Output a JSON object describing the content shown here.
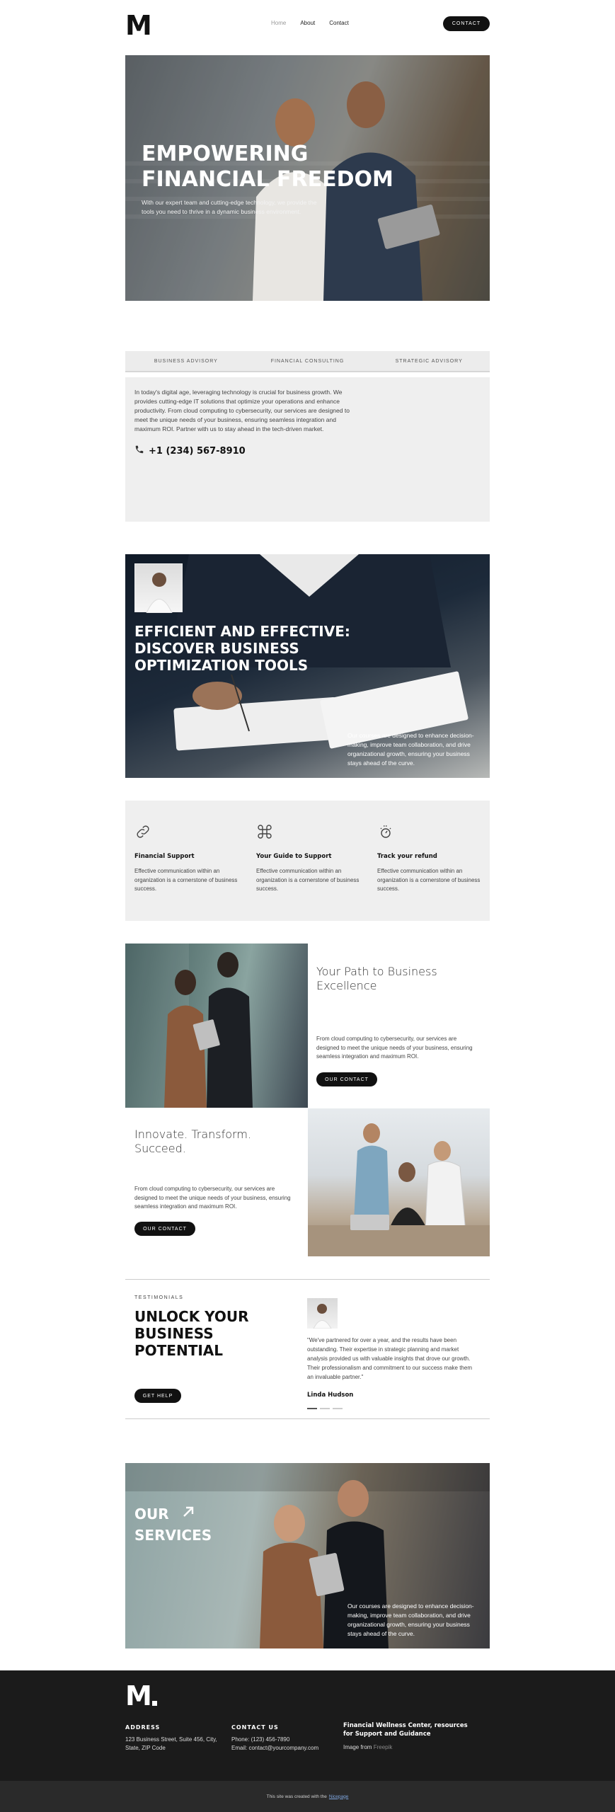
{
  "header": {
    "logo": "M",
    "nav": [
      "Home",
      "About",
      "Contact"
    ],
    "contact_button": "CONTACT"
  },
  "hero": {
    "title": "EMPOWERING FINANCIAL FREEDOM",
    "subtitle": "With our expert team and cutting-edge technology, we provide the tools you need to thrive in a dynamic business environment."
  },
  "tabs": [
    "BUSINESS ADVISORY",
    "FINANCIAL CONSULTING",
    "STRATEGIC ADVISORY"
  ],
  "panel": {
    "text": "In today's digital age, leveraging technology is crucial for business growth. We provides cutting-edge IT solutions that optimize your operations and enhance productivity. From cloud computing to cybersecurity, our services are designed to meet the unique needs of your business, ensuring seamless integration and maximum ROI. Partner with us to stay ahead in the tech-driven market.",
    "phone": "+1 (234) 567-8910"
  },
  "banner": {
    "title": "EFFICIENT AND EFFECTIVE: DISCOVER BUSINESS OPTIMIZATION TOOLS",
    "text": "Our courses are designed to enhance decision-making, improve team collaboration, and drive organizational growth, ensuring your business stays ahead of the curve."
  },
  "features": [
    {
      "icon": "link-icon",
      "title": "Financial Support",
      "text": "Effective communication within an organization is a cornerstone of business success."
    },
    {
      "icon": "command-icon",
      "title": "Your Guide to Support",
      "text": "Effective communication within an organization is a cornerstone of business success."
    },
    {
      "icon": "timer-icon",
      "title": "Track your refund",
      "text": "Effective communication within an organization is a cornerstone of business success."
    }
  ],
  "path": {
    "title": "Your Path to Business Excellence",
    "text": "From cloud computing to cybersecurity, our services are designed to meet the unique needs of your business, ensuring seamless integration and maximum ROI.",
    "button": "OUR CONTACT"
  },
  "innovate": {
    "title": "Innovate. Transform. Succeed.",
    "text": "From cloud computing to cybersecurity, our services are designed to meet the unique needs of your business, ensuring seamless integration and maximum ROI.",
    "button": "OUR CONTACT"
  },
  "testimonials": {
    "label": "TESTIMONIALS",
    "title": "UNLOCK YOUR BUSINESS POTENTIAL",
    "button": "GET HELP",
    "quote": "\"We've partnered for over a year, and the results have been outstanding. Their expertise in strategic planning and market analysis provided us with valuable insights that drove our growth. Their professionalism and commitment to our success make them an invaluable partner.\"",
    "name": "Linda Hudson"
  },
  "services": {
    "title": "OUR SERVICES",
    "text": "Our courses are designed to enhance decision-making, improve team collaboration, and drive organizational growth, ensuring your business stays ahead of the curve."
  },
  "footer": {
    "address_heading": "ADDRESS",
    "address": "123 Business Street, Suite 456, City, State, ZIP Code",
    "contact_heading": "CONTACT US",
    "phone": "Phone: (123) 456-7890",
    "email": "Email: contact@yourcompany.com",
    "about_heading": "Financial Wellness Center, resources for Support and Guidance",
    "image_prefix": "Image from",
    "image_source": "Freepik",
    "bottom_prefix": "This site was created with the",
    "bottom_link": "Nicepage"
  }
}
